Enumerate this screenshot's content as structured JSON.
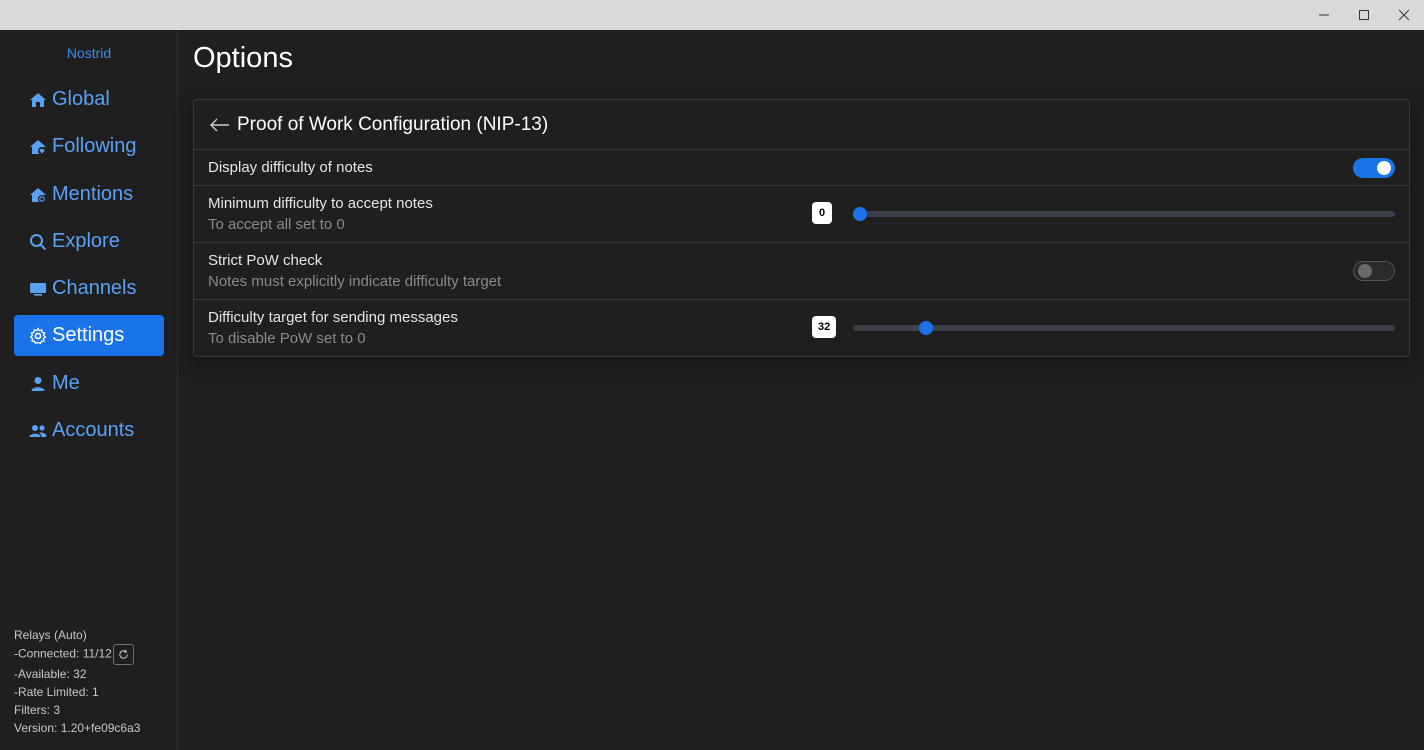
{
  "window": {
    "minimize_glyph": "—",
    "maximize_glyph": "☐",
    "close_glyph": "✕"
  },
  "sidebar": {
    "brand": "Nostrid",
    "items": [
      {
        "label": "Global",
        "icon": "home-icon"
      },
      {
        "label": "Following",
        "icon": "home-heart-icon"
      },
      {
        "label": "Mentions",
        "icon": "home-at-icon"
      },
      {
        "label": "Explore",
        "icon": "search-icon"
      },
      {
        "label": "Channels",
        "icon": "monitor-icon"
      },
      {
        "label": "Settings",
        "icon": "gear-icon",
        "active": true
      },
      {
        "label": "Me",
        "icon": "user-icon"
      },
      {
        "label": "Accounts",
        "icon": "users-icon"
      }
    ],
    "status": {
      "relays": "Relays (Auto)",
      "connected": "-Connected: 11/12",
      "available": "-Available: 32",
      "rate_limited": "-Rate Limited: 1",
      "filters": "Filters: 3",
      "version": "Version: 1.20+fe09c6a3"
    }
  },
  "main": {
    "title": "Options",
    "panel": {
      "title": "Proof of Work Configuration (NIP-13)",
      "rows": [
        {
          "label": "Display difficulty of notes",
          "toggle": true
        },
        {
          "label": "Minimum difficulty to accept notes",
          "hint": "To accept all set to 0",
          "value": "0",
          "min": 0,
          "max": 256
        },
        {
          "label": "Strict PoW check",
          "hint": "Notes must explicitly indicate difficulty target",
          "toggle": false
        },
        {
          "label": "Difficulty target for sending messages",
          "hint": "To disable PoW set to 0",
          "value": "32",
          "min": 0,
          "max": 256
        }
      ]
    }
  },
  "colors": {
    "accent": "#1a73e8",
    "link": "#5aa0f5",
    "background": "#1f1f1f"
  }
}
